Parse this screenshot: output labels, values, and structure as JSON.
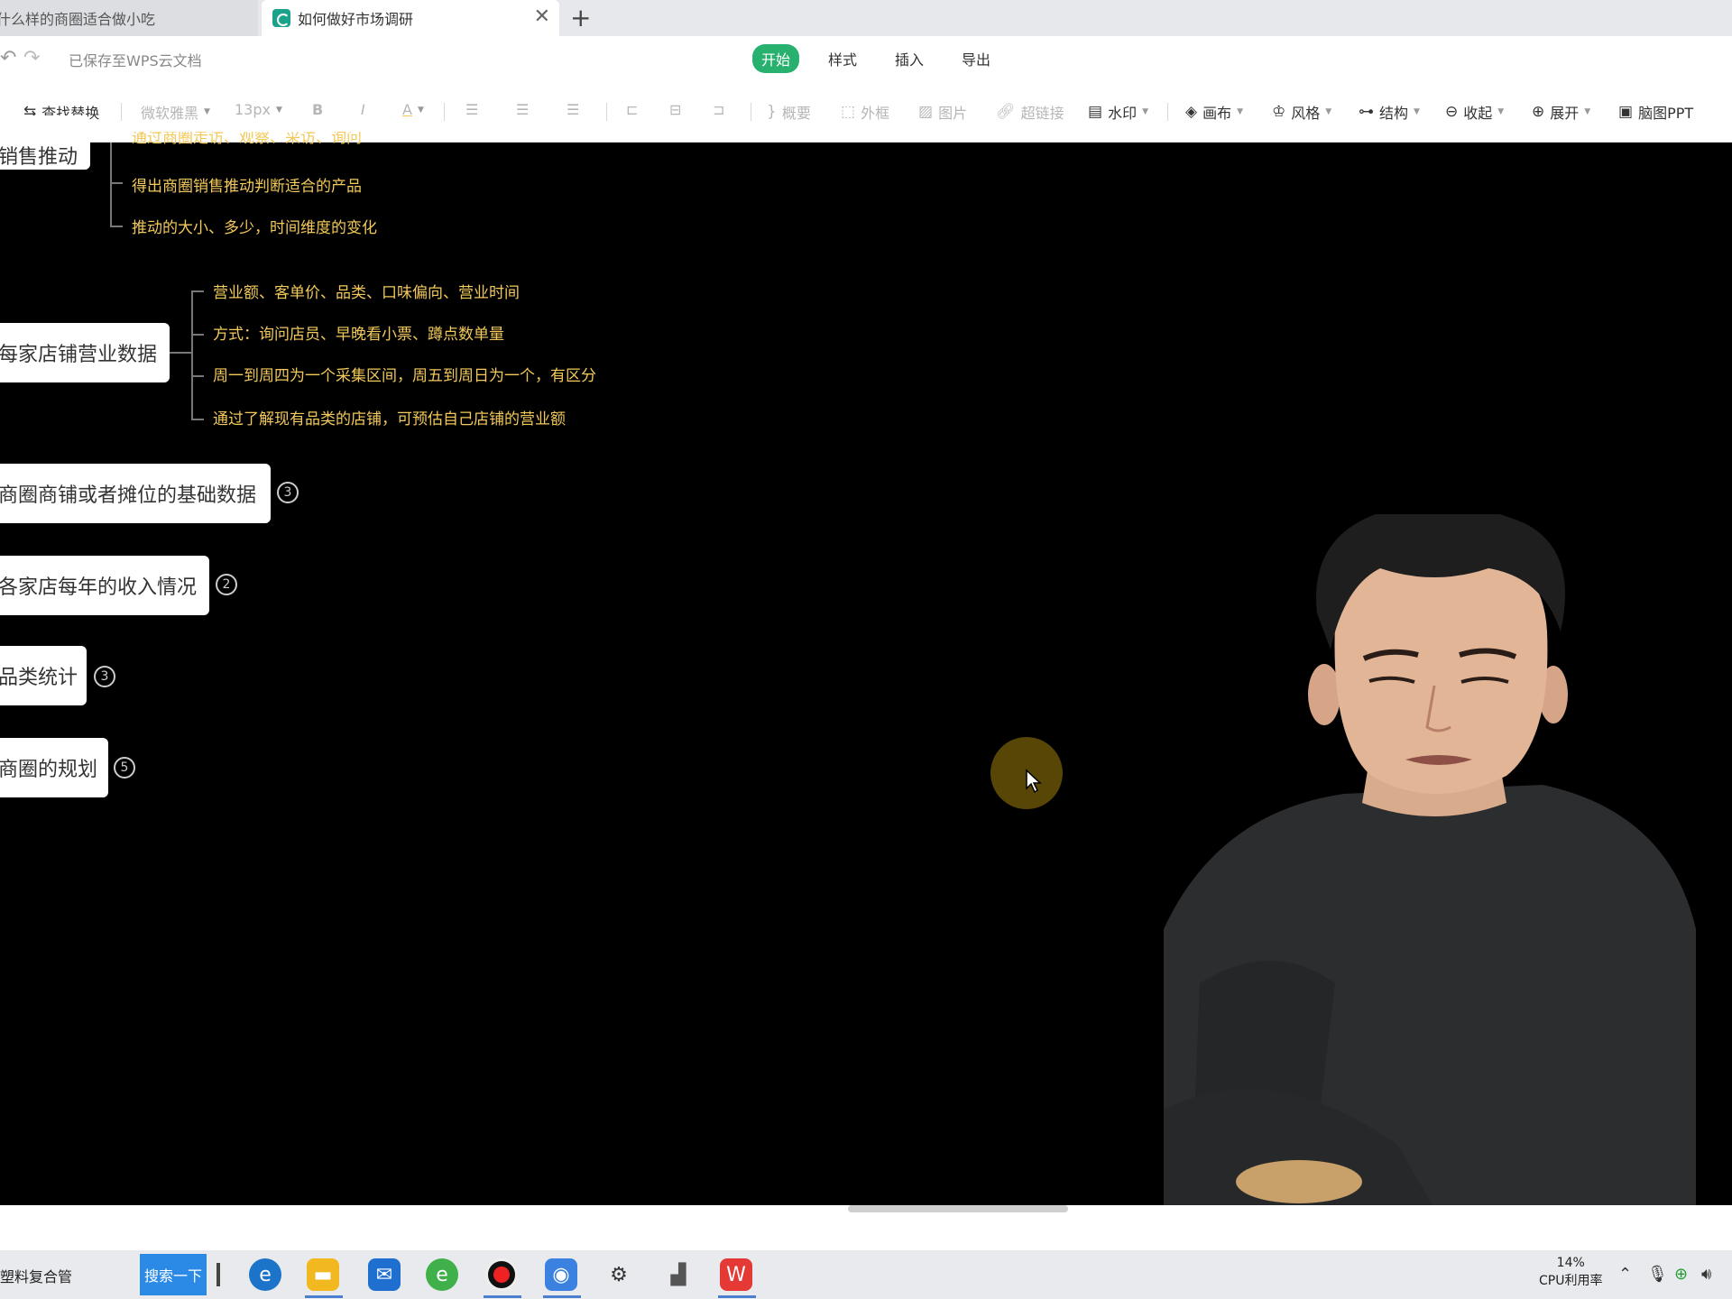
{
  "browser": {
    "tabs": [
      {
        "title": "什么样的商圈适合做小吃",
        "active": false
      },
      {
        "title": "如何做好市场调研",
        "active": true
      }
    ],
    "new_tab": "+",
    "close_glyph": "✕"
  },
  "header": {
    "saved_status": "已保存至WPS云文档",
    "menu": [
      "开始",
      "样式",
      "插入",
      "导出"
    ],
    "active_menu": "开始"
  },
  "toolbar": {
    "find_replace": "查找替换",
    "font_family": "微软雅黑",
    "font_size": "13px",
    "bold": "B",
    "italic": "I",
    "font_color": "A",
    "summary": "概要",
    "border": "外框",
    "image": "图片",
    "hyperlink": "超链接",
    "watermark": "水印",
    "canvas": "画布",
    "style": "风格",
    "structure": "结构",
    "collapse": "收起",
    "expand": "展开",
    "mindmap_ppt": "脑图PPT"
  },
  "mindmap": {
    "partial_top_node": "销售推动",
    "partial_top_leaf": "通过商圈走访、观察、采访、询问",
    "top_leaves": [
      "得出商圈销售推动判断适合的产品",
      "推动的大小、多少，时间维度的变化"
    ],
    "node_store_data": "每家店铺营业数据",
    "store_leaves": [
      "营业额、客单价、品类、口味偏向、营业时间",
      "方式：询问店员、早晚看小票、蹲点数单量",
      "周一到周四为一个采集区间，周五到周日为一个，有区分",
      "通过了解现有品类的店铺，可预估自己店铺的营业额"
    ],
    "collapsed_nodes": [
      {
        "label": "商圈商铺或者摊位的基础数据",
        "count": "3"
      },
      {
        "label": "各家店每年的收入情况",
        "count": "2"
      },
      {
        "label": "品类统计",
        "count": "3"
      },
      {
        "label": "商圈的规划",
        "count": "5"
      }
    ]
  },
  "taskbar": {
    "search_text": "塑料复合管",
    "search_button": "搜索一下",
    "cpu_percent": "14%",
    "cpu_label": "CPU利用率",
    "apps": [
      "edge-icon",
      "folder-icon",
      "mail-icon",
      "browser-icon",
      "record-icon",
      "camera-icon",
      "settings-icon",
      "tool-icon",
      "wps-icon"
    ]
  },
  "colors": {
    "accent_green": "#27b06e",
    "leaf_text": "#f2c95a",
    "canvas_bg": "#000000",
    "taskbar_search": "#2b8ae6"
  }
}
